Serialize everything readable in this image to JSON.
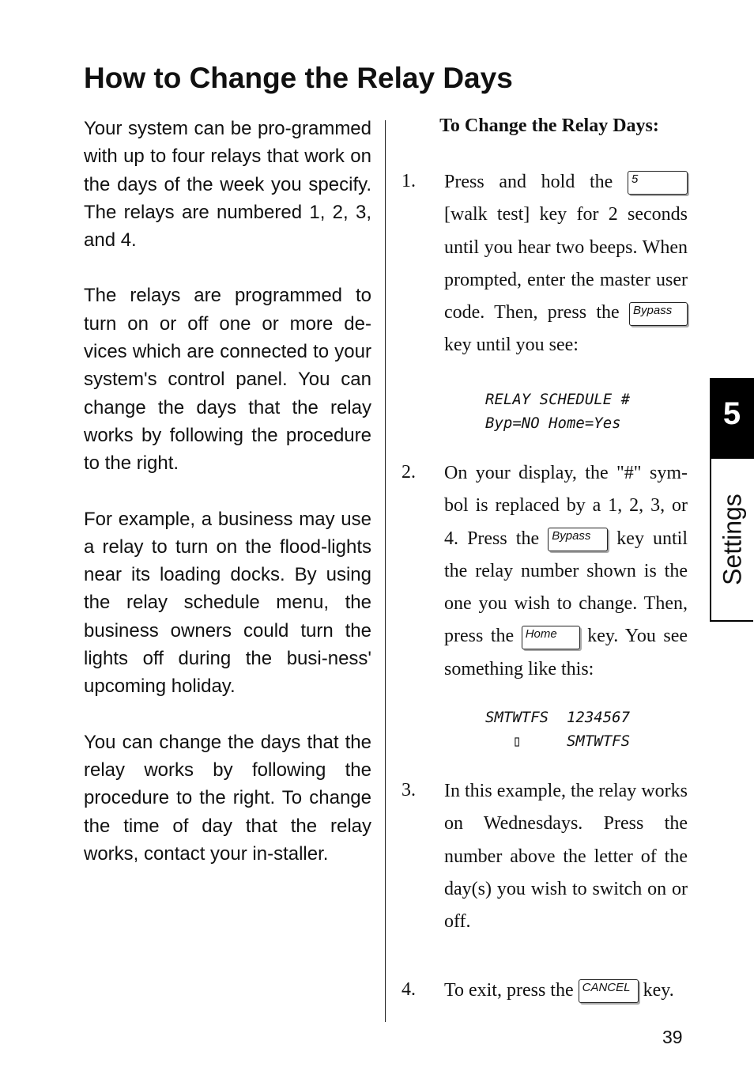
{
  "title": "How to Change the Relay Days",
  "left_paragraphs": [
    "Your system can be pro-grammed with up to four relays that work on the days of the week you specify. The relays are numbered 1, 2, 3, and 4.",
    "The relays are programmed to turn on or off one or more de-vices which are connected to your system's control panel. You can change the days that the relay works by following the procedure to the right.",
    "For example, a business may use a relay to turn on the flood-lights near its loading docks.  By using the relay schedule menu, the business owners could turn the lights off during the busi-ness' upcoming holiday.",
    "You can change the days that the relay works by following the procedure to the right.  To change the time of day that the relay works, contact your in-staller."
  ],
  "right_heading": "To Change the Relay Days:",
  "steps": [
    {
      "num": "1.",
      "a": "Press and hold the",
      "key1": "5",
      "b": "[walk test] key for 2 seconds until you hear two beeps. When prompted, enter the master user code. Then, press the",
      "key2": "Bypass",
      "c": "key until you see:"
    },
    {
      "num": "2.",
      "a": "On your display, the \"#\" sym-bol is replaced by a 1, 2, 3, or 4.  Press the",
      "key1": "Bypass",
      "b": "key until the relay number shown is the one you wish to change. Then, press the",
      "key2": "Home",
      "c": "key. You see something like this:"
    },
    {
      "num": "3.",
      "a": "In this example, the relay works on Wednesdays.  Press the number above the letter of the day(s) you wish to switch on or off."
    },
    {
      "num": "4.",
      "a": "To exit, press the",
      "key1": "CANCEL",
      "b": "key."
    }
  ],
  "display1": {
    "line1": "RELAY SCHEDULE #",
    "line2": "Byp=NO Home=Yes"
  },
  "display2": {
    "line1": "SMTWTFS  1234567",
    "line2": "   ▯     SMTWTFS"
  },
  "tab": {
    "number": "5",
    "label": "Settings"
  },
  "page_number": "39"
}
